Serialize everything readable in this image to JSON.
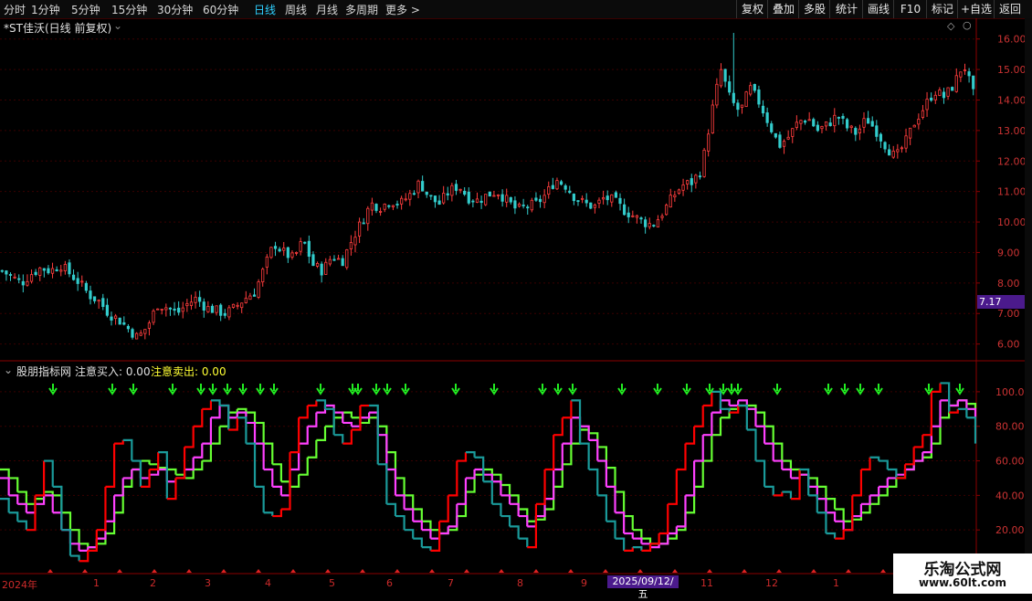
{
  "toolbar": {
    "periods": [
      "分时",
      "1分钟",
      "5分钟",
      "15分钟",
      "30分钟",
      "60分钟",
      "日线",
      "周线",
      "月线",
      "多周期",
      "更多 >"
    ],
    "active_period": "日线",
    "right_buttons": [
      "复权",
      "叠加",
      "多股",
      "统计",
      "画线",
      "F10",
      "标记",
      "+自选",
      "返回"
    ]
  },
  "main_chart": {
    "title": "*ST佳沃(日线 前复权)",
    "current_price_label": "7.17"
  },
  "indicator": {
    "name": "股朋指标网",
    "buy_label": "注意买入: 0.00",
    "sell_label": "注意卖出: 0.00"
  },
  "date_axis": {
    "labels": [
      "2024年",
      "1",
      "2",
      "3",
      "4",
      "5",
      "6",
      "7",
      "8",
      "9",
      "11",
      "12",
      "1"
    ],
    "highlight": "2025/09/12/五"
  },
  "watermark": {
    "line1": "乐淘公式网",
    "line2": "www.60lt.com"
  },
  "colors": {
    "up": "#ff3d3d",
    "down": "#33cccc",
    "bg": "#000000",
    "axis": "#8b0000",
    "k_line": "#ff40ff",
    "d_line": "#66ff33",
    "j_up": "#ff0000",
    "j_down": "#1a9a9a",
    "arrow": "#22ee22"
  },
  "chart_data": [
    {
      "type": "candlestick",
      "y_axis_ticks": [
        16.0,
        15.0,
        14.0,
        13.0,
        12.0,
        11.0,
        10.0,
        9.0,
        8.0,
        7.0,
        6.0
      ],
      "ylim": [
        5.6,
        16.5
      ],
      "close_series": [
        8.4,
        8.2,
        8.0,
        8.3,
        8.5,
        8.4,
        8.6,
        8.3,
        8.0,
        7.6,
        7.4,
        7.0,
        6.8,
        6.5,
        6.2,
        6.6,
        7.3,
        7.2,
        7.0,
        7.3,
        7.5,
        7.2,
        7.1,
        7.0,
        7.2,
        7.5,
        7.7,
        8.5,
        9.3,
        9.0,
        8.8,
        9.4,
        8.6,
        8.4,
        8.9,
        8.7,
        9.4,
        10.0,
        10.6,
        10.5,
        10.7,
        10.6,
        10.9,
        11.3,
        10.8,
        10.6,
        11.0,
        11.2,
        10.8,
        10.7,
        10.9,
        11.0,
        10.7,
        10.4,
        10.5,
        10.6,
        10.9,
        11.4,
        11.2,
        10.8,
        10.6,
        10.5,
        10.8,
        10.7,
        10.4,
        10.2,
        10.0,
        9.9,
        10.3,
        10.8,
        11.2,
        11.3,
        11.7,
        13.5,
        15.0,
        14.0,
        13.6,
        14.4,
        13.9,
        13.2,
        12.5,
        12.8,
        13.3,
        13.4,
        13.0,
        13.2,
        13.5,
        13.1,
        12.9,
        13.4,
        13.0,
        12.5,
        12.1,
        12.6,
        13.3,
        13.8,
        14.3,
        14.1,
        14.5,
        15.2,
        14.2
      ]
    },
    {
      "type": "line",
      "y_axis_ticks": [
        100.0,
        80.0,
        60.0,
        40.0,
        20.0
      ],
      "ylim": [
        0,
        110
      ],
      "series": [
        {
          "values": [
            50,
            40,
            35,
            30,
            35,
            40,
            30,
            20,
            12,
            8,
            10,
            15,
            25,
            40,
            50,
            55,
            50,
            52,
            55,
            48,
            50,
            55,
            62,
            70,
            85,
            92,
            85,
            88,
            82,
            70,
            55,
            45,
            40,
            55,
            70,
            80,
            88,
            92,
            88,
            82,
            80,
            85,
            88,
            75,
            55,
            40,
            32,
            25,
            20,
            15,
            18,
            22,
            35,
            50,
            55,
            52,
            48,
            40,
            35,
            28,
            22,
            28,
            38,
            55,
            70,
            85,
            80,
            72,
            60,
            45,
            30,
            18,
            15,
            12,
            10,
            12,
            18,
            22,
            40,
            60,
            75,
            88,
            95,
            92,
            95,
            90,
            80,
            70,
            60,
            55,
            50,
            52,
            45,
            38,
            30,
            25,
            20,
            28,
            35,
            40,
            45,
            50,
            52,
            55,
            60,
            65,
            80,
            95,
            92,
            95,
            90,
            85
          ]
        },
        {
          "values": [
            55,
            50,
            42,
            35,
            38,
            42,
            40,
            30,
            20,
            12,
            10,
            12,
            18,
            30,
            45,
            55,
            60,
            58,
            56,
            55,
            52,
            50,
            55,
            60,
            70,
            80,
            88,
            90,
            88,
            82,
            70,
            58,
            48,
            45,
            52,
            62,
            72,
            80,
            85,
            88,
            85,
            82,
            85,
            80,
            65,
            50,
            40,
            32,
            25,
            20,
            18,
            20,
            28,
            42,
            52,
            55,
            52,
            46,
            40,
            32,
            25,
            26,
            32,
            45,
            58,
            70,
            78,
            76,
            68,
            56,
            42,
            28,
            20,
            15,
            12,
            12,
            15,
            20,
            30,
            45,
            60,
            75,
            85,
            90,
            92,
            92,
            88,
            80,
            70,
            60,
            55,
            52,
            50,
            45,
            38,
            32,
            25,
            26,
            30,
            35,
            40,
            45,
            50,
            55,
            60,
            62,
            70,
            85,
            92,
            95,
            93,
            90
          ]
        },
        {
          "values": [
            38,
            30,
            25,
            20,
            40,
            60,
            45,
            20,
            5,
            2,
            8,
            20,
            45,
            70,
            72,
            60,
            45,
            55,
            65,
            38,
            50,
            68,
            80,
            90,
            95,
            92,
            78,
            85,
            70,
            45,
            30,
            28,
            32,
            65,
            85,
            92,
            95,
            90,
            75,
            70,
            78,
            92,
            92,
            58,
            35,
            28,
            20,
            15,
            10,
            8,
            25,
            40,
            60,
            65,
            62,
            48,
            35,
            28,
            22,
            15,
            10,
            35,
            55,
            75,
            85,
            95,
            70,
            55,
            40,
            25,
            15,
            8,
            10,
            8,
            12,
            18,
            35,
            55,
            70,
            80,
            92,
            100,
            90,
            88,
            92,
            78,
            60,
            45,
            40,
            42,
            38,
            55,
            40,
            30,
            18,
            15,
            20,
            40,
            55,
            62,
            60,
            55,
            50,
            58,
            68,
            75,
            100,
            105,
            88,
            90,
            85,
            70
          ]
        }
      ]
    }
  ]
}
